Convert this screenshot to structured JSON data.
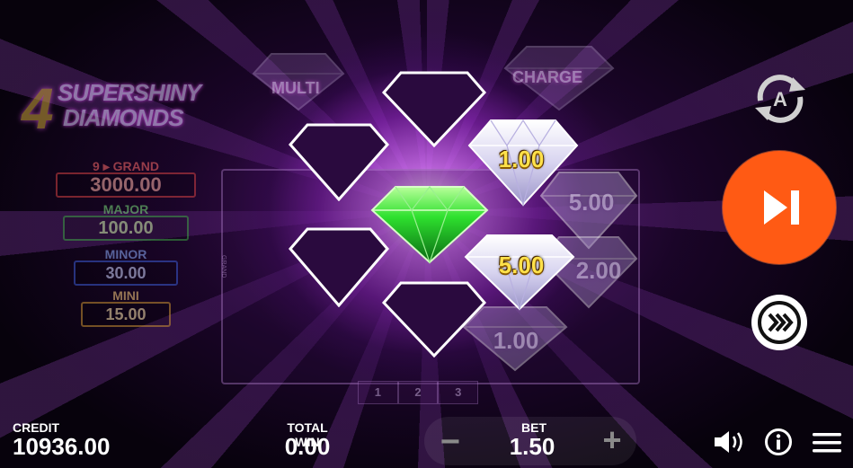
{
  "game": {
    "logo": {
      "digit": "4",
      "line1": "SUPERSHINY",
      "line2": "DIAMONDS"
    },
    "modifiers": {
      "left": "MULTI",
      "right": "CHARGE"
    },
    "jackpots": {
      "grand": {
        "label": "GRAND",
        "value": "3000.00",
        "badge": "9"
      },
      "major": {
        "label": "MAJOR",
        "value": "100.00"
      },
      "minor": {
        "label": "MINOR",
        "value": "30.00"
      },
      "mini": {
        "label": "MINI",
        "value": "15.00"
      }
    },
    "gem_values": {
      "white_top": "1.00",
      "white_bottom": "5.00",
      "faded_right_top": "5.00",
      "faded_right_middle": "2.00",
      "faded_bottom": "1.00"
    },
    "pages": [
      "1",
      "2",
      "3"
    ],
    "side_label": "GRAND"
  },
  "icons": {
    "autoplay": "autoplay-a-icon",
    "spin": "skip-forward-icon",
    "turbo": "fast-forward-icon",
    "sound": "speaker-icon",
    "info": "info-icon",
    "menu": "hamburger-menu-icon"
  },
  "bottom_bar": {
    "credit_label": "CREDIT",
    "credit_value": "10936.00",
    "total_win_label": "TOTAL WIN",
    "total_win_value": "0.00",
    "bet_label": "BET",
    "bet_value": "1.50",
    "bet_minus": "−",
    "bet_plus": "+"
  },
  "colors": {
    "spin_button": "#ff5a14",
    "glow": "#c050ff",
    "gem_value": "#ffe14a",
    "green_gem": "#2ee02e"
  }
}
